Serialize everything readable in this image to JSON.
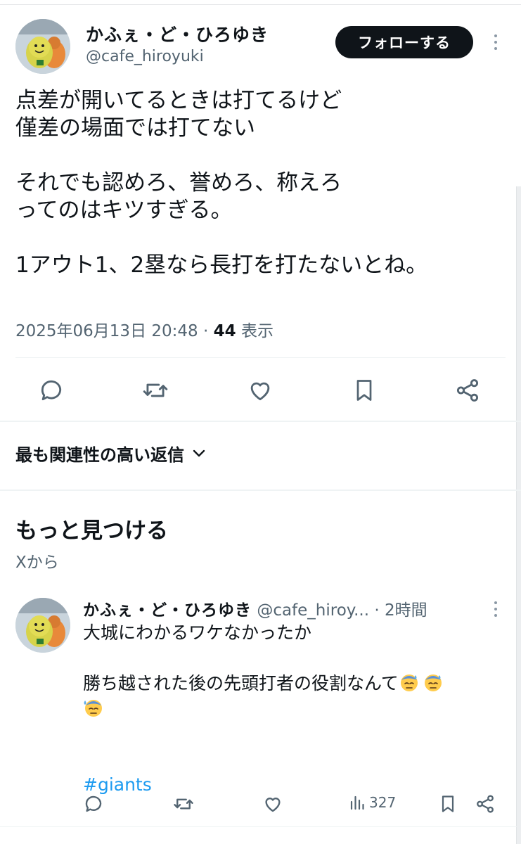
{
  "main_tweet": {
    "author_name": "かふぇ・ど・ひろゆき",
    "author_handle": "@cafe_hiroyuki",
    "follow_label": "フォローする",
    "lines": [
      "点差が開いてるときは打てるけど",
      "僅差の場面では打てない",
      "",
      "それでも認めろ、誉めろ、称えろ",
      "ってのはキツすぎる。",
      "",
      "1アウト1、2塁なら長打を打たないとね。"
    ],
    "timestamp": "2025年06月13日 20:48",
    "separator": "·",
    "views_count": "44",
    "views_label": "表示",
    "actions": [
      "reply-icon",
      "retweet-icon",
      "like-icon",
      "bookmark-icon",
      "share-icon"
    ]
  },
  "replies_sort": {
    "label": "最も関連性の高い返信"
  },
  "discover": {
    "title": "もっと見つける",
    "subtitle": "Xから"
  },
  "suggested_tweet": {
    "author_name": "かふぇ・ど・ひろゆき",
    "author_handle": "@cafe_hiroy...",
    "separator": "·",
    "time": "2時間",
    "line1": "大城にわかるワケなかったか",
    "line2": "勝ち越された後の先頭打者の役割なんて",
    "emoji_name": "downcast-face-with-sweat-emoji",
    "hashtag": "#giants",
    "views_count": "327"
  },
  "colors": {
    "text": "#0f1419",
    "secondary": "#536471",
    "link": "#1d9bf0",
    "follow_bg": "#0f1419",
    "divider": "#eff3f4"
  }
}
